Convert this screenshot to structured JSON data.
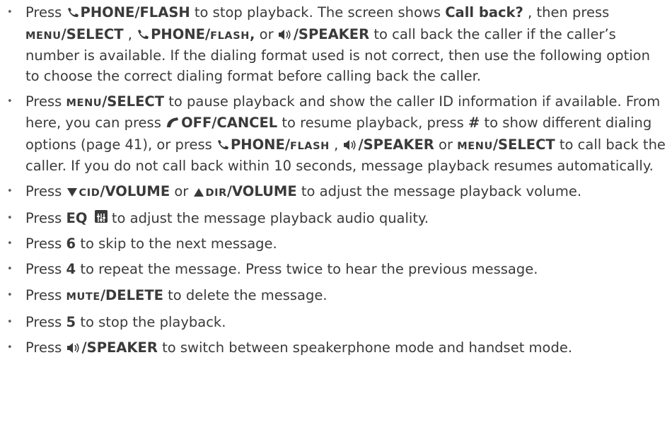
{
  "bullets": [
    {
      "parts": [
        "Press ",
        "PHONE/FLASH",
        " to stop playback. The screen shows ",
        "Call back?",
        ", then press ",
        "MENU",
        "/SELECT",
        ", ",
        "PHONE/",
        "FLASH",
        ",",
        " or ",
        "/SPEAKER",
        " to call back the caller if the caller’s number is available. If the dialing format used is not correct, then use the following option to choose the correct dialing format before calling back the caller."
      ]
    },
    {
      "parts": [
        "Press ",
        "MENU",
        "/SELECT",
        " to pause playback and show the caller ID information if available. From here, you can press ",
        "OFF/CANCEL",
        " to resume playback, press ",
        "#",
        " to show different dialing options (page 41), or press ",
        "PHONE/",
        "FLASH",
        ", ",
        "/SPEAKER",
        " or ",
        "MENU",
        "/SELECT",
        " to call back the caller. If you do not call back within 10 seconds, message playback resumes automatically."
      ]
    },
    {
      "parts": [
        "Press ",
        "CID",
        "/VOLUME",
        " or ",
        "DIR",
        "/VOLUME",
        " to adjust the message playback volume."
      ]
    },
    {
      "parts": [
        "Press ",
        "EQ",
        " to adjust the message playback audio quality."
      ]
    },
    {
      "parts": [
        "Press ",
        "6",
        " to skip to the next message."
      ]
    },
    {
      "parts": [
        "Press ",
        "4",
        " to repeat the message. Press twice to hear the previous message."
      ]
    },
    {
      "parts": [
        "Press ",
        "MUTE",
        "/DELETE",
        " to delete the message."
      ]
    },
    {
      "parts": [
        "Press ",
        "5",
        " to stop the playback."
      ]
    },
    {
      "parts": [
        "Press ",
        "/SPEAKER",
        " to switch between speakerphone mode and handset mode."
      ]
    }
  ],
  "icons": {
    "phone": "phone-icon",
    "speaker": "speaker-icon",
    "off": "off-cancel-icon",
    "down": "down-triangle-icon",
    "up": "up-triangle-icon",
    "eq": "eq-icon"
  }
}
